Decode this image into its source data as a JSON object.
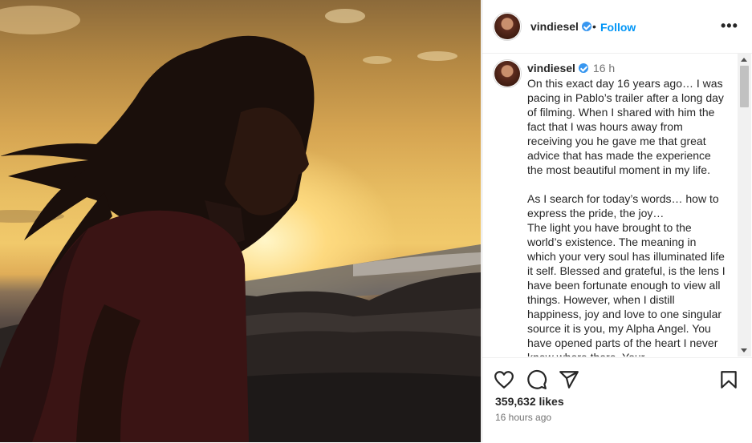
{
  "post": {
    "username": "vindiesel",
    "follow_label": "Follow",
    "separator": "•",
    "more_label": "•••",
    "caption_time": "16 h",
    "caption": "On this exact day 16 years ago… I was pacing in Pablo’s trailer after a long day of filming. When I shared with him the fact that I was hours away from receiving you he gave me that great advice that has made the experience the most beautiful moment in my life.\n\nAs I search for today’s words… how to express the pride, the joy…\nThe light you have brought to the world’s existence. The meaning in which your very soul has illuminated life it self. Blessed and grateful, is the lens I have been fortunate enough to view all things. However, when I distill happiness, joy and love to one singular source it is you, my Alpha Angel. You have opened parts of the heart I never knew where there. Your",
    "likes": "359,632 likes",
    "posted_ago": "16 hours ago"
  },
  "icons": {
    "like": "heart-icon",
    "comment": "comment-icon",
    "share": "send-icon",
    "save": "bookmark-icon",
    "verified": "verified-badge-icon",
    "more": "more-options-icon"
  },
  "colors": {
    "accent": "#0095f6",
    "verified": "#3897f0",
    "muted_text": "#737373"
  }
}
